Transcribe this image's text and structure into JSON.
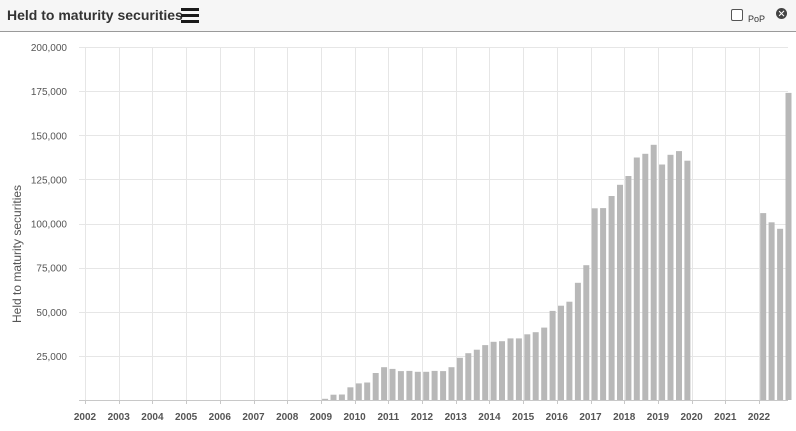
{
  "header": {
    "title": "Held to maturity securities",
    "pop_label": "PoP",
    "menu_icon": "hamburger-menu-icon",
    "close_icon": "close-circle-icon",
    "pop_checked": false
  },
  "chart_data": {
    "type": "bar",
    "title": "",
    "xlabel": "",
    "ylabel": "Held to maturity securities",
    "ylim": [
      0,
      200000
    ],
    "y_ticks": [
      "25,000",
      "50,000",
      "75,000",
      "100,000",
      "125,000",
      "150,000",
      "175,000",
      "200,000"
    ],
    "y_tick_values": [
      25000,
      50000,
      75000,
      100000,
      125000,
      150000,
      175000,
      200000
    ],
    "x_ticks": [
      "2002",
      "2003",
      "2004",
      "2005",
      "2006",
      "2007",
      "2008",
      "2009",
      "2010",
      "2011",
      "2012",
      "2013",
      "2014",
      "2015",
      "2016",
      "2017",
      "2018",
      "2019",
      "2020",
      "2021",
      "2022"
    ],
    "x_tick_values": [
      2002,
      2003,
      2004,
      2005,
      2006,
      2007,
      2008,
      2009,
      2010,
      2011,
      2012,
      2013,
      2014,
      2015,
      2016,
      2017,
      2018,
      2019,
      2020,
      2021,
      2022
    ],
    "bar_color": "#b8b8b8",
    "grid": true,
    "grid_color": "#e6e6e6",
    "legend": "none",
    "categories": [
      "2009 Q1",
      "2009 Q2",
      "2009 Q3",
      "2009 Q4",
      "2010 Q1",
      "2010 Q2",
      "2010 Q3",
      "2010 Q4",
      "2011 Q1",
      "2011 Q2",
      "2011 Q3",
      "2011 Q4",
      "2012 Q1",
      "2012 Q2",
      "2012 Q3",
      "2012 Q4",
      "2013 Q1",
      "2013 Q2",
      "2013 Q3",
      "2013 Q4",
      "2014 Q1",
      "2014 Q2",
      "2014 Q3",
      "2014 Q4",
      "2015 Q1",
      "2015 Q2",
      "2015 Q3",
      "2015 Q4",
      "2016 Q1",
      "2016 Q2",
      "2016 Q3",
      "2016 Q4",
      "2017 Q1",
      "2017 Q2",
      "2017 Q3",
      "2017 Q4",
      "2018 Q1",
      "2018 Q2",
      "2018 Q3",
      "2018 Q4",
      "2019 Q1",
      "2019 Q2",
      "2019 Q3",
      "2019 Q4",
      "2022 Q1",
      "2022 Q2",
      "2022 Q3",
      "2022 Q4"
    ],
    "x": [
      2009.0,
      2009.25,
      2009.5,
      2009.75,
      2010.0,
      2010.25,
      2010.5,
      2010.75,
      2011.0,
      2011.25,
      2011.5,
      2011.75,
      2012.0,
      2012.25,
      2012.5,
      2012.75,
      2013.0,
      2013.25,
      2013.5,
      2013.75,
      2014.0,
      2014.25,
      2014.5,
      2014.75,
      2015.0,
      2015.25,
      2015.5,
      2015.75,
      2016.0,
      2016.25,
      2016.5,
      2016.75,
      2017.0,
      2017.25,
      2017.5,
      2017.75,
      2018.0,
      2018.25,
      2018.5,
      2018.75,
      2019.0,
      2019.25,
      2019.5,
      2019.75,
      2022.0,
      2022.25,
      2022.5,
      2022.75
    ],
    "values": [
      700,
      3000,
      3100,
      7200,
      9400,
      9900,
      15300,
      18600,
      17600,
      16400,
      16500,
      16000,
      16000,
      16500,
      16400,
      18600,
      23900,
      26500,
      28500,
      31100,
      33000,
      33300,
      34900,
      34900,
      37200,
      38400,
      41000,
      50500,
      53400,
      55700,
      66400,
      76400,
      108600,
      108700,
      115600,
      121900,
      126900,
      137400,
      139500,
      144600,
      133400,
      138900,
      141000,
      135600,
      105900,
      100700,
      97000,
      174000
    ]
  }
}
